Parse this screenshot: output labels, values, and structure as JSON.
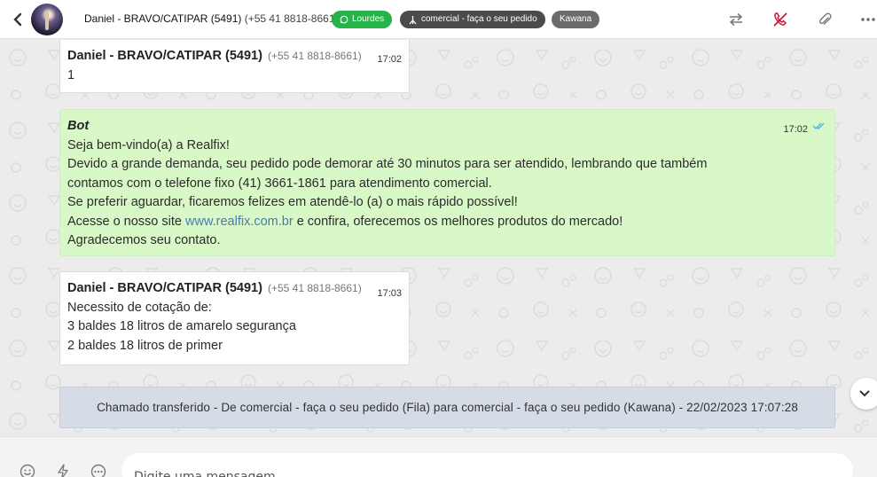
{
  "header": {
    "contact_name": "Daniel - BRAVO/CATIPAR (5491)",
    "contact_phone": "(+55 41 8818-8661)",
    "tags": [
      {
        "label": "Lourdes",
        "icon": "whatsapp-icon",
        "color": "#25b34a"
      },
      {
        "label": "comercial - faça o seu pedido",
        "icon": "queue-icon",
        "color": "#4b4b4b"
      },
      {
        "label": "Kawana",
        "icon": "",
        "color": "#6b6b6b"
      }
    ],
    "actions": [
      "transfer-icon",
      "end-call-icon",
      "attachment-icon",
      "more-icon"
    ]
  },
  "messages": [
    {
      "sender": "Daniel - BRAVO/CATIPAR (5491)",
      "phone": "(+55 41 8818-8661)",
      "time": "17:02",
      "lines": [
        "1"
      ]
    },
    {
      "sender": "Bot",
      "time": "17:02",
      "status": "read",
      "lines": [
        "Seja bem-vindo(a) a Realfix!",
        "Devido a grande demanda, seu pedido pode demorar até 30 minutos para ser atendido, lembrando que também",
        "contamos com o telefone fixo (41) 3661-1861 para atendimento comercial.",
        "Se preferir aguardar, ficaremos felizes em atendê-lo (a) o mais rápido possível!"
      ],
      "site_prefix": "Acesse o nosso site ",
      "site_link": "www.realfix.com.br",
      "site_suffix": " e confira, oferecemos os melhores produtos do mercado!",
      "closing": "Agradecemos seu contato."
    },
    {
      "sender": "Daniel - BRAVO/CATIPAR (5491)",
      "phone": "(+55 41 8818-8661)",
      "time": "17:03",
      "lines": [
        "Necessito de cotação de:",
        "3 baldes 18 litros de amarelo segurança",
        "2 baldes 18 litros de primer"
      ]
    }
  ],
  "notice": "Chamado transferido - De comercial - faça o seu pedido (Fila) para comercial - faça o seu pedido (Kawana) - 22/02/2023 17:07:28",
  "footer": {
    "placeholder": "Digite uma mensagem",
    "icons": [
      "emoji-icon",
      "quick-reply-icon",
      "more-options-icon"
    ]
  },
  "colors": {
    "bot_bubble": "#d9f8c7",
    "notice_bg": "#d5dce6",
    "link": "#4a7bb0",
    "end_call": "#c8102e",
    "read_ticks": "#4fb3e8"
  }
}
